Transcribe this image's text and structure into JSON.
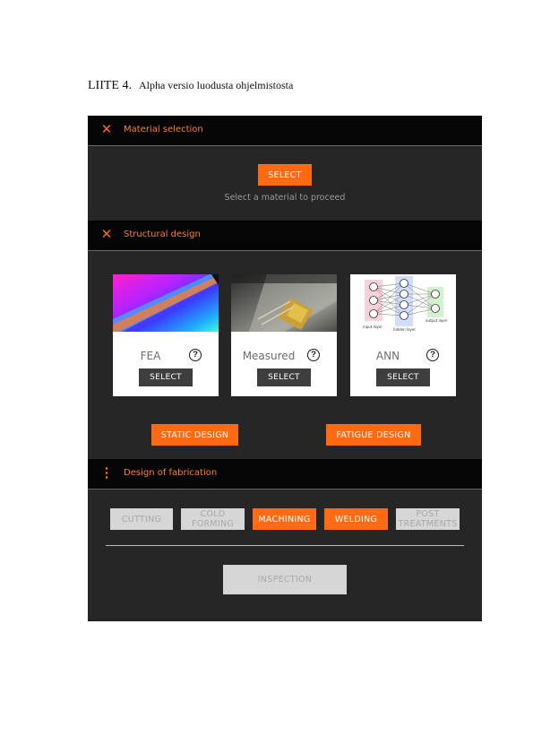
{
  "page": {
    "appendix_label": "LIITE 4.",
    "caption": "Alpha versio luodusta ohjelmistosta"
  },
  "material_selection": {
    "title": "Material selection",
    "icon": "close-icon",
    "select_label": "SELECT",
    "hint": "Select a material to proceed"
  },
  "structural_design": {
    "title": "Structural design",
    "icon": "close-icon",
    "cards": [
      {
        "name": "FEA",
        "select_label": "SELECT",
        "image": "fea-contour-image"
      },
      {
        "name": "Measured",
        "select_label": "SELECT",
        "image": "strain-gauge-photo"
      },
      {
        "name": "ANN",
        "select_label": "SELECT",
        "image": "neural-network-diagram"
      }
    ],
    "ann_diagram": {
      "input_label": "input layer",
      "hidden_label": "hidden layer",
      "output_label": "output layer"
    },
    "static_label": "STATIC DESIGN",
    "fatigue_label": "FATIGUE DESIGN"
  },
  "fabrication": {
    "title": "Design of fabrication",
    "icon": "more-vertical-icon",
    "steps": [
      {
        "label": "CUTTING",
        "enabled": false
      },
      {
        "label": "COLD\nFORMING",
        "enabled": false
      },
      {
        "label": "MACHINING",
        "enabled": true
      },
      {
        "label": "WELDING",
        "enabled": true
      },
      {
        "label": "POST\nTREATMENTS",
        "enabled": false
      }
    ],
    "inspection_label": "INSPECTION"
  },
  "colors": {
    "accent": "#ff6a13",
    "header_bg": "#050505",
    "panel_bg": "#262626",
    "disabled_bg": "#d6d6d6"
  }
}
